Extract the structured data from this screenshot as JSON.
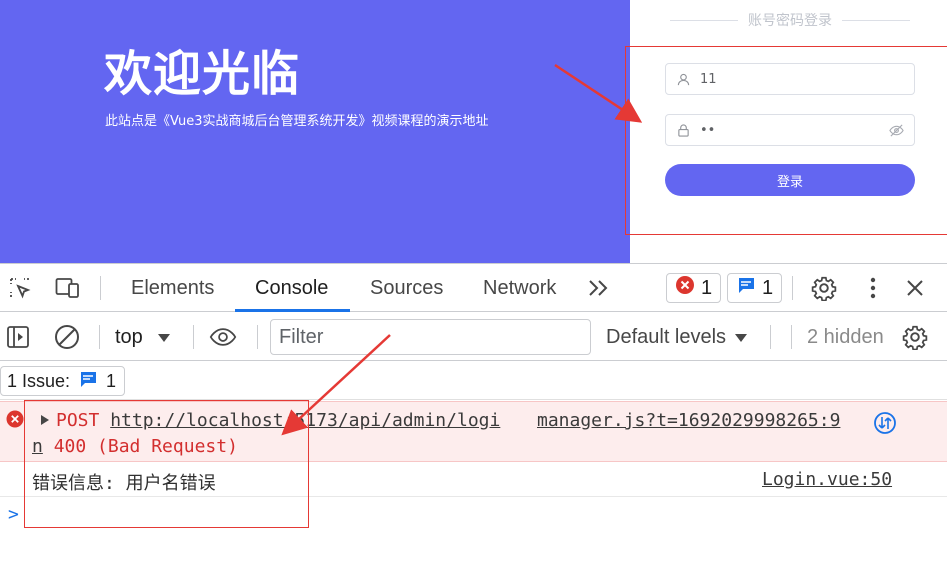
{
  "app": {
    "hero_title": "欢迎光临",
    "hero_subtitle": "此站点是《Vue3实战商城后台管理系统开发》视频课程的演示地址",
    "login_heading": "账号密码登录",
    "username_value": "11",
    "password_value": "••",
    "login_button": "登录",
    "accent_color": "#6366f1"
  },
  "devtools": {
    "tabs": [
      {
        "label": "Elements"
      },
      {
        "label": "Console"
      },
      {
        "label": "Sources"
      },
      {
        "label": "Network"
      }
    ],
    "active_tab": "Console",
    "more_tabs_glyph": ">>",
    "error_count": "1",
    "message_count": "1",
    "context": "top",
    "filter_placeholder": "Filter",
    "levels_label": "Default levels",
    "hidden_label": "2 hidden",
    "issues_label": "1 Issue:",
    "issues_count": "1"
  },
  "console": {
    "error": {
      "method": "POST",
      "url": "http://localhost:5173/api/admin/logi",
      "url_cont": "n",
      "status": "400 (Bad Request)",
      "source": "manager.js?t=1692029998265:9"
    },
    "log": {
      "message": "错误信息: 用户名错误",
      "source": "Login.vue:50"
    },
    "prompt_glyph": ">"
  },
  "colors": {
    "error_red": "#d32f2f",
    "error_bg": "#fdeded",
    "link_blue": "#1a73e8",
    "annotation_red": "#e53935"
  }
}
